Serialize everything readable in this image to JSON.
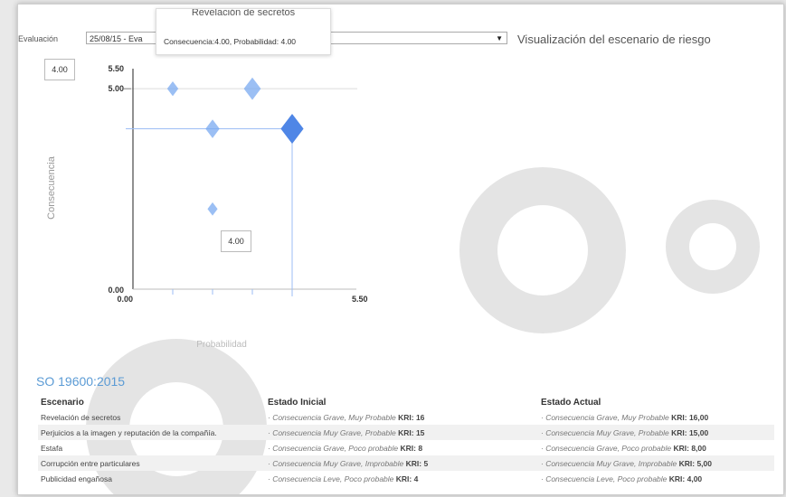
{
  "evaluation": {
    "label": "Evaluación",
    "selected": "25/08/15 - Eva"
  },
  "visualization_title": "Visualización del escenario de riesgo",
  "tooltip": {
    "title": "Revelación de secretos",
    "text": "Consecuencia:4.00, Probabilidad: 4.00"
  },
  "value_boxes": {
    "top": "4.00",
    "center": "4.00"
  },
  "chart_data": {
    "type": "scatter",
    "xlabel": "Probabilidad",
    "ylabel": "Consecuencia",
    "xlim": [
      0,
      5.5
    ],
    "ylim": [
      0,
      5.5
    ],
    "x_ticks": [
      "0.00",
      "5.50"
    ],
    "y_ticks": [
      "0.00",
      "5.00",
      "5.50"
    ],
    "points": [
      {
        "x": 1,
        "y": 5,
        "size": 1
      },
      {
        "x": 3,
        "y": 5,
        "size": 2
      },
      {
        "x": 2,
        "y": 4,
        "size": 1.5
      },
      {
        "x": 4,
        "y": 4,
        "size": 3
      },
      {
        "x": 2,
        "y": 2,
        "size": 0.8
      }
    ],
    "highlight": {
      "x": 4,
      "y": 4
    },
    "colors": {
      "point": "#7aaaf0",
      "point_dark": "#4f86e6",
      "crosshair": "#9dbef5",
      "grid": "#dcdcdc"
    }
  },
  "section_title": "SO 19600:2015",
  "table": {
    "headers": {
      "scenario": "Escenario",
      "initial": "Estado Inicial",
      "current": "Estado Actual"
    },
    "rows": [
      {
        "scenario": "Revelación de secretos",
        "initial_text": "· Consecuencia Grave, Muy Probable",
        "initial_kri": "KRI: 16",
        "current_text": "· Consecuencia Grave, Muy Probable",
        "current_kri": "KRI: 16,00"
      },
      {
        "scenario": "Perjuicios a la imagen y reputación de la compañía.",
        "initial_text": "· Consecuencia Muy Grave, Probable",
        "initial_kri": "KRI: 15",
        "current_text": "· Consecuencia Muy Grave, Probable",
        "current_kri": "KRI: 15,00"
      },
      {
        "scenario": "Estafa",
        "initial_text": "· Consecuencia Grave, Poco probable",
        "initial_kri": "KRI: 8",
        "current_text": "· Consecuencia Grave, Poco probable",
        "current_kri": "KRI: 8,00"
      },
      {
        "scenario": "Corrupción entre particulares",
        "initial_text": "· Consecuencia Muy Grave, Improbable",
        "initial_kri": "KRI: 5",
        "current_text": "· Consecuencia Muy Grave, Improbable",
        "current_kri": "KRI: 5,00"
      },
      {
        "scenario": "Publicidad engañosa",
        "initial_text": "· Consecuencia Leve, Poco probable",
        "initial_kri": "KRI: 4",
        "current_text": "· Consecuencia Leve, Poco probable",
        "current_kri": "KRI: 4,00"
      }
    ]
  }
}
